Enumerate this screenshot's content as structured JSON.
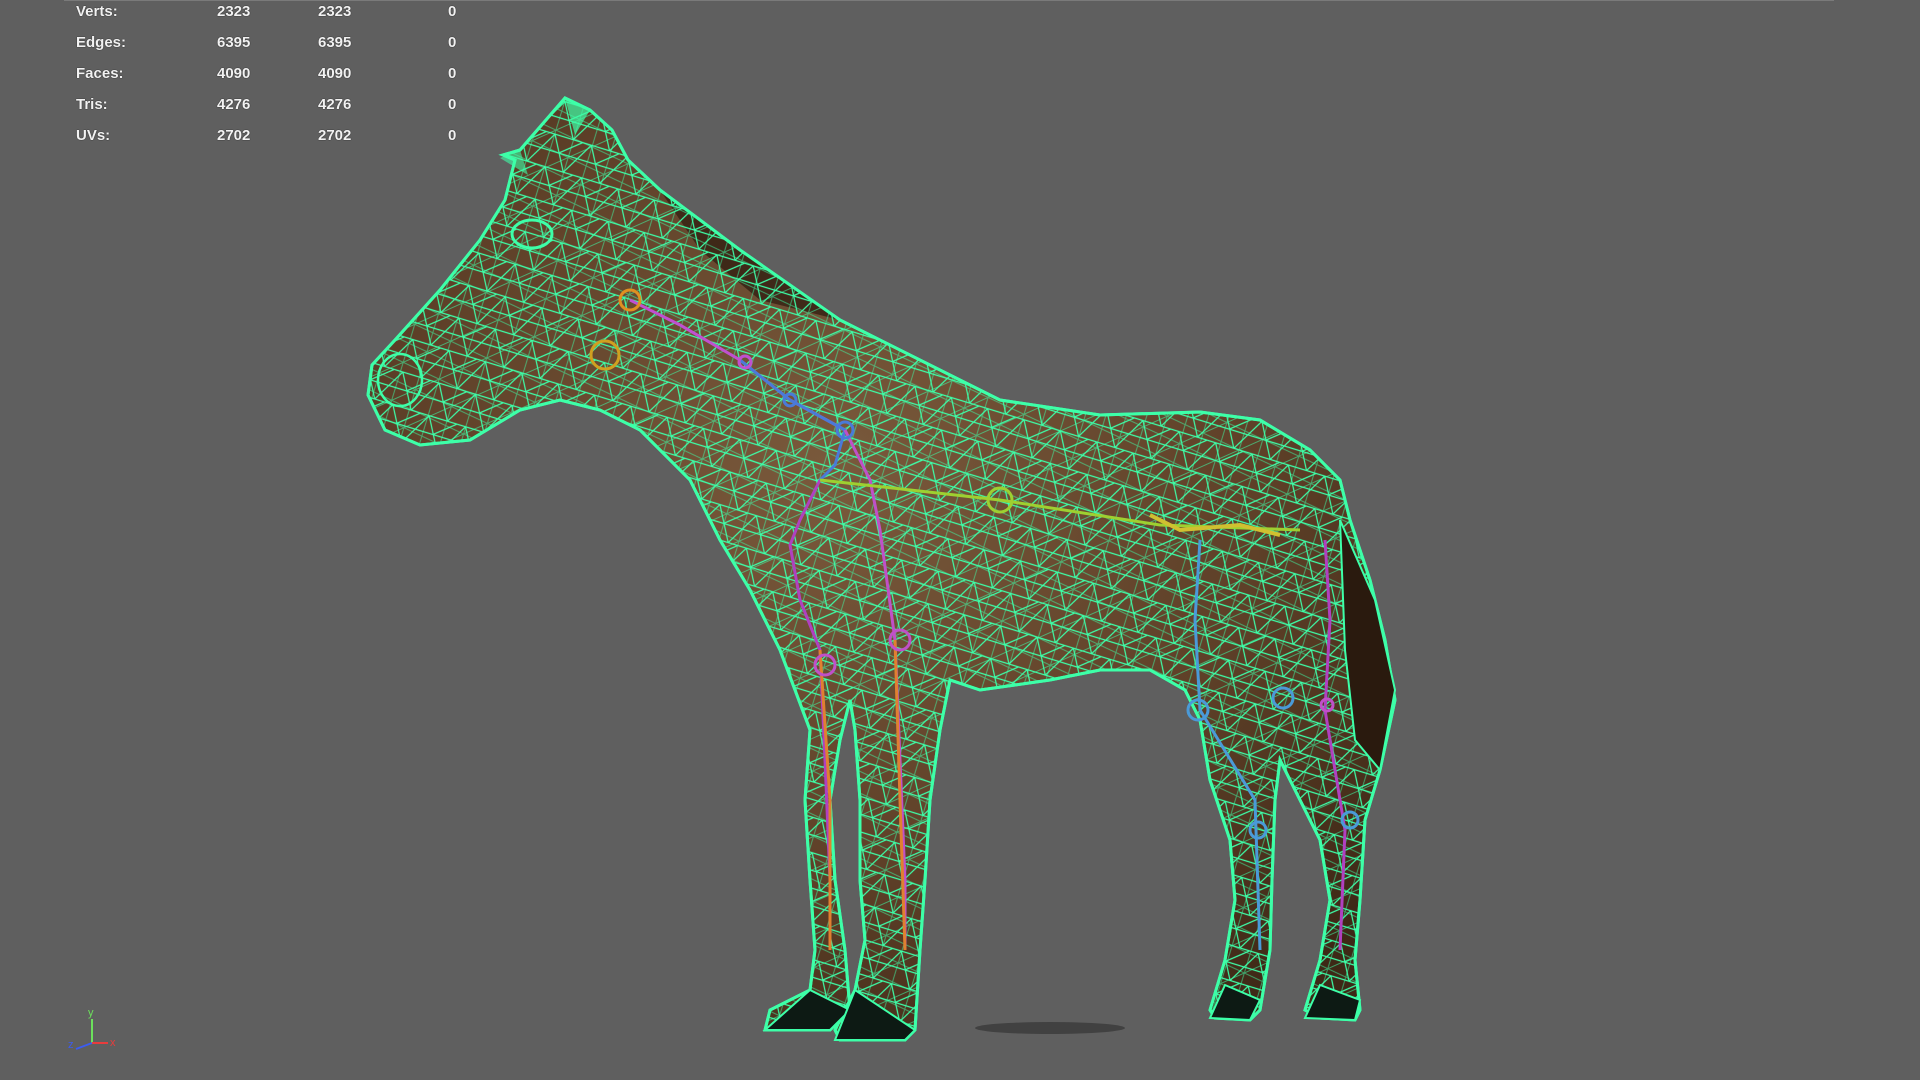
{
  "stats": [
    {
      "label": "Verts:",
      "total": "2323",
      "selected": "2323",
      "tri_count": "0"
    },
    {
      "label": "Edges:",
      "total": "6395",
      "selected": "6395",
      "tri_count": "0"
    },
    {
      "label": "Faces:",
      "total": "4090",
      "selected": "4090",
      "tri_count": "0"
    },
    {
      "label": "Tris:",
      "total": "4276",
      "selected": "4276",
      "tri_count": "0"
    },
    {
      "label": "UVs:",
      "total": "2702",
      "selected": "2702",
      "tri_count": "0"
    }
  ],
  "axis": {
    "x": "x",
    "y": "y",
    "z": "z"
  },
  "colors": {
    "background": "#5f5f5f",
    "wireframe": "#3dffa8",
    "body": "#6a4a30",
    "x_axis": "#e83c3c",
    "y_axis": "#6ce05c",
    "z_axis": "#3c5cf0"
  }
}
